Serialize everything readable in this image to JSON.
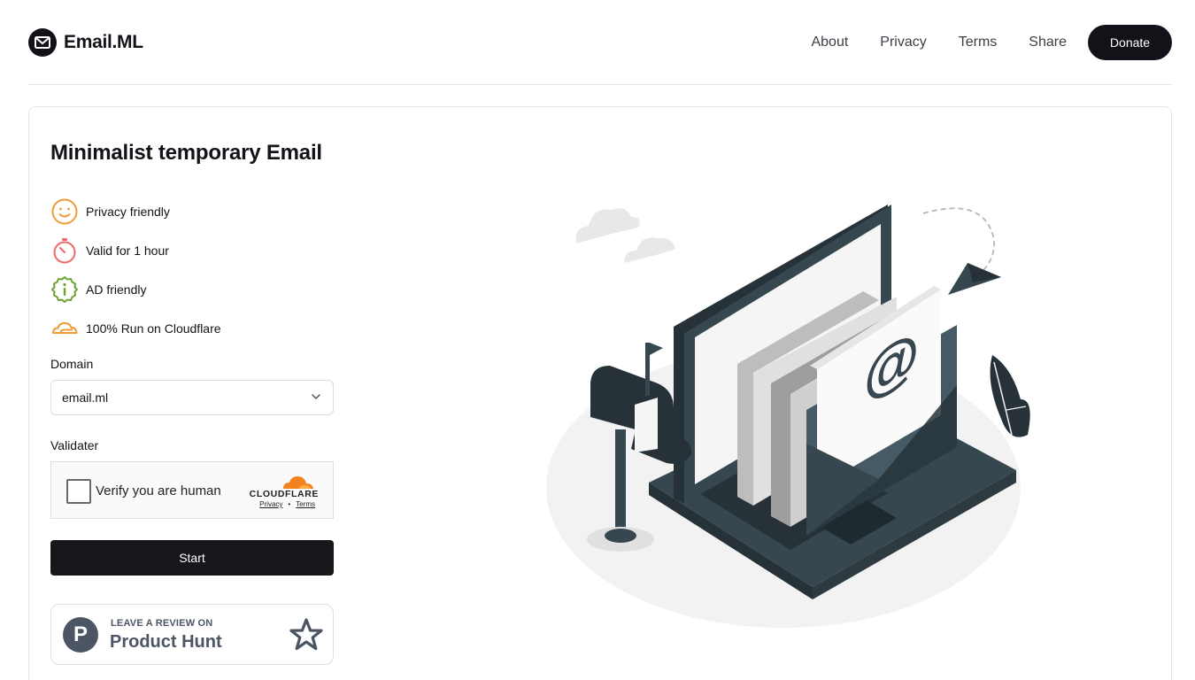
{
  "app": {
    "name": "Email.ML"
  },
  "nav": {
    "links": [
      "About",
      "Privacy",
      "Terms",
      "Share"
    ],
    "donate_label": "Donate"
  },
  "main": {
    "title": "Minimalist temporary Email",
    "features": [
      {
        "icon": "smile-icon",
        "label": "Privacy friendly",
        "color": "#f29a38"
      },
      {
        "icon": "stopwatch-icon",
        "label": "Valid for 1 hour",
        "color": "#ef6b6b"
      },
      {
        "icon": "info-badge-icon",
        "label": "AD friendly",
        "color": "#6ba32e"
      },
      {
        "icon": "cloud-icon",
        "label": "100% Run on Cloudflare",
        "color": "#f29a38"
      }
    ],
    "domain": {
      "label": "Domain",
      "value": "email.ml"
    },
    "validater": {
      "label": "Validater",
      "checkbox_text": "Verify you are human",
      "provider": "CLOUDFLARE",
      "privacy_link": "Privacy",
      "separator": "•",
      "terms_link": "Terms"
    },
    "start_label": "Start",
    "product_hunt": {
      "top_text": "LEAVE A REVIEW ON",
      "bottom_text": "Product Hunt",
      "logo_letter": "P"
    }
  },
  "colors": {
    "primary": "#111318",
    "accent_orange": "#f29a38",
    "cloudflare_orange": "#f48120",
    "illustration_dark": "#37474f"
  }
}
